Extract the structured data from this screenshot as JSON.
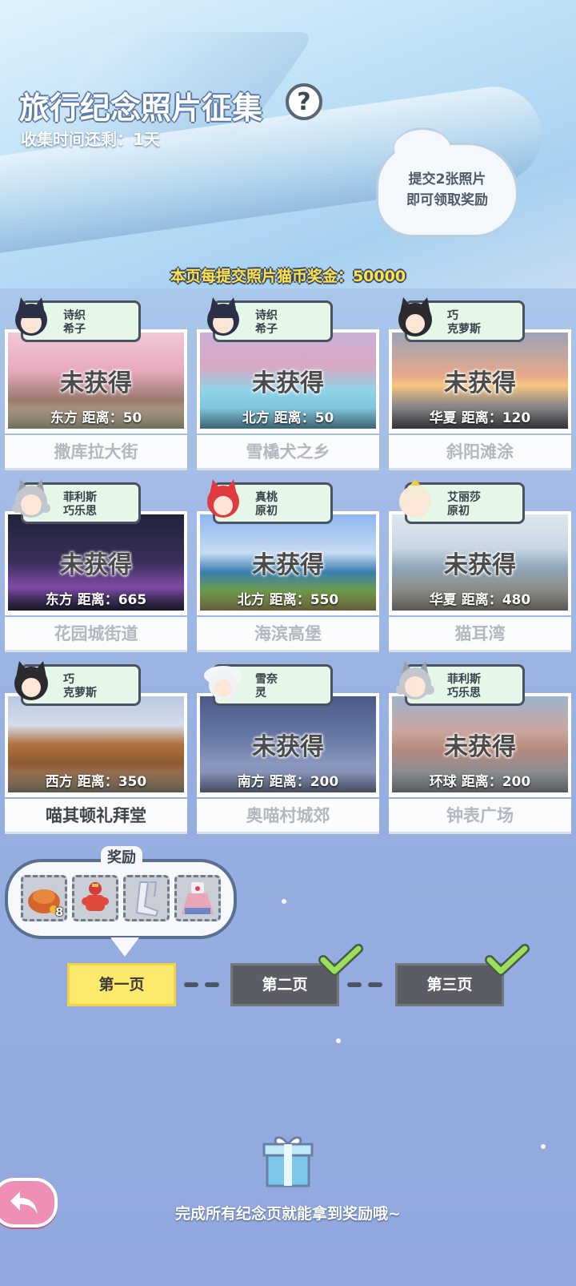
{
  "header": {
    "title": "旅行纪念照片征集",
    "help_icon": "question-icon",
    "help_symbol": "?",
    "timer_text": "收集时间还剩：1天",
    "cloud_line1": "提交2张照片",
    "cloud_line2": "即可领取奖励",
    "bonus_text": "本页每提交照片猫币奖金：50000"
  },
  "cards": [
    {
      "tag1": "诗织",
      "tag2": "希子",
      "state": "未获得",
      "dist": "东方  距离：50",
      "name": "撒库拉大街",
      "obtained": false
    },
    {
      "tag1": "诗织",
      "tag2": "希子",
      "state": "未获得",
      "dist": "北方  距离：50",
      "name": "雪橇犬之乡",
      "obtained": false
    },
    {
      "tag1": "巧",
      "tag2": "克萝斯",
      "state": "未获得",
      "dist": "华夏  距离：120",
      "name": "斜阳滩涂",
      "obtained": false
    },
    {
      "tag1": "菲利斯",
      "tag2": "巧乐思",
      "state": "未获得",
      "dist": "东方  距离：665",
      "name": "花园城街道",
      "obtained": false
    },
    {
      "tag1": "真桃",
      "tag2": "原初",
      "state": "未获得",
      "dist": "北方  距离：550",
      "name": "海滨高堡",
      "obtained": false
    },
    {
      "tag1": "艾丽莎",
      "tag2": "原初",
      "state": "未获得",
      "dist": "华夏  距离：480",
      "name": "猫耳湾",
      "obtained": false
    },
    {
      "tag1": "巧",
      "tag2": "克萝斯",
      "state": "",
      "dist": "西方  距离：350",
      "name": "喵其顿礼拜堂",
      "obtained": true
    },
    {
      "tag1": "雪奈",
      "tag2": "灵",
      "state": "未获得",
      "dist": "南方  距离：200",
      "name": "奥喵村城郊",
      "obtained": false
    },
    {
      "tag1": "菲利斯",
      "tag2": "巧乐思",
      "state": "未获得",
      "dist": "环球  距离：200",
      "name": "钟表广场",
      "obtained": false
    }
  ],
  "reward": {
    "title": "奖励",
    "items": [
      {
        "icon": "cat-food-bag-icon",
        "count": "8"
      },
      {
        "icon": "red-lantern-costume-icon",
        "count": ""
      },
      {
        "icon": "stockings-icon",
        "count": ""
      },
      {
        "icon": "dress-costume-icon",
        "count": ""
      }
    ]
  },
  "pages": [
    {
      "label": "第一页",
      "state": "active"
    },
    {
      "label": "第二页",
      "state": "done"
    },
    {
      "label": "第三页",
      "state": "done"
    }
  ],
  "footer": {
    "finish_text": "完成所有纪念页就能拿到奖励哦~"
  },
  "colors": {
    "bonus_yellow": "#ffe24a",
    "active_page": "#fde96b",
    "done_page": "#5a5e64",
    "check_green": "#9be05a",
    "back_button": "#ef8fb5"
  }
}
